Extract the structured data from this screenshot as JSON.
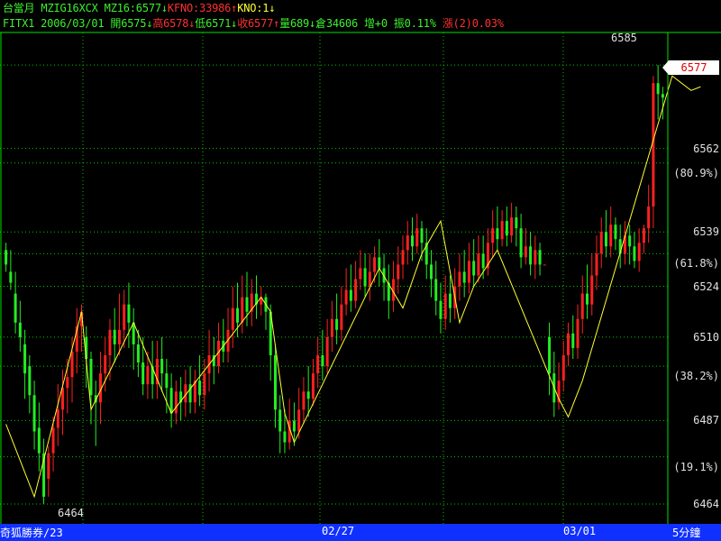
{
  "header": {
    "line1": [
      {
        "text": "台當月 MZIG16XCX MZ16:6577↓",
        "color": "grn"
      },
      {
        "text": "KFNO:33986↑",
        "color": "red"
      },
      {
        "text": "KNO:1↓",
        "color": "yel"
      }
    ],
    "line2": [
      {
        "text": "FITX1 2006/03/01 開6575↓",
        "color": "grn"
      },
      {
        "text": "高6578↓",
        "color": "red"
      },
      {
        "text": "低6571↓",
        "color": "grn"
      },
      {
        "text": "收6577↑",
        "color": "red"
      },
      {
        "text": "量689↓倉34606 增+0 振0.11% ",
        "color": "grn"
      },
      {
        "text": "漲(2)0.03%",
        "color": "red"
      }
    ]
  },
  "chart_data": {
    "type": "candlestick",
    "ylim": [
      6462,
      6590
    ],
    "y_ticks": [
      6585,
      6562,
      6539,
      6524,
      6510,
      6487,
      6464
    ],
    "fib_levels": [
      {
        "label": "(80.9%)",
        "value": 6558
      },
      {
        "label": "(61.8%)",
        "value": 6533
      },
      {
        "label": "(38.2%)",
        "value": 6502
      },
      {
        "label": "(19.1%)",
        "value": 6477
      }
    ],
    "x_labels": [
      {
        "text": "奇狐勝券/23",
        "slot": 0
      },
      {
        "text": "02/27",
        "slot": 1
      },
      {
        "text": "03/01",
        "slot": 2
      }
    ],
    "timeframe": "5分鐘",
    "last_price": "6577",
    "high_label": "6585",
    "low_label": "6464",
    "colors": {
      "up": "#ff2020",
      "down": "#22ee22",
      "zigzag": "#ffff30",
      "grid": "#00c800",
      "axis": "#00e000"
    },
    "zigzag": [
      [
        0,
        6486
      ],
      [
        6,
        6466
      ],
      [
        16,
        6517
      ],
      [
        18,
        6490
      ],
      [
        27,
        6514
      ],
      [
        35,
        6489
      ],
      [
        54,
        6521
      ],
      [
        56,
        6517
      ],
      [
        59,
        6489
      ],
      [
        61,
        6481
      ],
      [
        79,
        6529
      ],
      [
        84,
        6518
      ],
      [
        88,
        6533
      ],
      [
        92,
        6542
      ],
      [
        96,
        6514
      ],
      [
        99,
        6524
      ],
      [
        104,
        6534
      ],
      [
        117,
        6493
      ],
      [
        119,
        6488
      ],
      [
        122,
        6498
      ],
      [
        141,
        6582
      ],
      [
        145,
        6578
      ],
      [
        147,
        6579
      ]
    ],
    "candles": [
      [
        6534,
        6530,
        6536,
        6528
      ],
      [
        6528,
        6525,
        6534,
        6523
      ],
      [
        6522,
        6514,
        6528,
        6511
      ],
      [
        6514,
        6510,
        6520,
        6506
      ],
      [
        6508,
        6500,
        6512,
        6493
      ],
      [
        6502,
        6494,
        6505,
        6489
      ],
      [
        6494,
        6484,
        6498,
        6479
      ],
      [
        6485,
        6478,
        6492,
        6473
      ],
      [
        6478,
        6466,
        6482,
        6464
      ],
      [
        6471,
        6478,
        6480,
        6466
      ],
      [
        6478,
        6485,
        6488,
        6473
      ],
      [
        6485,
        6490,
        6497,
        6480
      ],
      [
        6490,
        6496,
        6501,
        6483
      ],
      [
        6496,
        6499,
        6504,
        6489
      ],
      [
        6499,
        6506,
        6510,
        6492
      ],
      [
        6506,
        6513,
        6518,
        6500
      ],
      [
        6513,
        6517,
        6519,
        6506
      ],
      [
        6510,
        6504,
        6513,
        6496
      ],
      [
        6504,
        6494,
        6506,
        6486
      ],
      [
        6494,
        6492,
        6498,
        6480
      ],
      [
        6492,
        6500,
        6506,
        6486
      ],
      [
        6500,
        6505,
        6510,
        6495
      ],
      [
        6505,
        6512,
        6515,
        6498
      ],
      [
        6512,
        6508,
        6518,
        6503
      ],
      [
        6508,
        6512,
        6522,
        6505
      ],
      [
        6512,
        6519,
        6523,
        6507
      ],
      [
        6519,
        6514,
        6525,
        6507
      ],
      [
        6514,
        6508,
        6518,
        6501
      ],
      [
        6508,
        6503,
        6512,
        6499
      ],
      [
        6503,
        6497,
        6510,
        6494
      ],
      [
        6497,
        6502,
        6506,
        6493
      ],
      [
        6502,
        6497,
        6509,
        6493
      ],
      [
        6497,
        6504,
        6509,
        6493
      ],
      [
        6504,
        6500,
        6510,
        6495
      ],
      [
        6500,
        6496,
        6504,
        6489
      ],
      [
        6496,
        6489,
        6500,
        6485
      ],
      [
        6489,
        6495,
        6498,
        6486
      ],
      [
        6495,
        6492,
        6499,
        6487
      ],
      [
        6492,
        6497,
        6501,
        6488
      ],
      [
        6497,
        6492,
        6502,
        6489
      ],
      [
        6492,
        6498,
        6501,
        6489
      ],
      [
        6498,
        6494,
        6505,
        6491
      ],
      [
        6494,
        6500,
        6504,
        6490
      ],
      [
        6500,
        6505,
        6512,
        6495
      ],
      [
        6505,
        6502,
        6510,
        6497
      ],
      [
        6502,
        6509,
        6514,
        6500
      ],
      [
        6509,
        6506,
        6515,
        6503
      ],
      [
        6506,
        6512,
        6518,
        6503
      ],
      [
        6512,
        6518,
        6524,
        6507
      ],
      [
        6518,
        6514,
        6525,
        6510
      ],
      [
        6514,
        6521,
        6527,
        6511
      ],
      [
        6521,
        6517,
        6528,
        6513
      ],
      [
        6517,
        6522,
        6526,
        6513
      ],
      [
        6522,
        6519,
        6527,
        6515
      ],
      [
        6519,
        6521,
        6524,
        6516
      ],
      [
        6521,
        6517,
        6522,
        6512
      ],
      [
        6517,
        6505,
        6519,
        6498
      ],
      [
        6505,
        6490,
        6508,
        6485
      ],
      [
        6490,
        6484,
        6494,
        6478
      ],
      [
        6484,
        6481,
        6490,
        6478
      ],
      [
        6481,
        6487,
        6493,
        6479
      ],
      [
        6487,
        6484,
        6492,
        6480
      ],
      [
        6484,
        6490,
        6496,
        6482
      ],
      [
        6490,
        6495,
        6499,
        6486
      ],
      [
        6495,
        6493,
        6502,
        6488
      ],
      [
        6493,
        6500,
        6504,
        6491
      ],
      [
        6500,
        6505,
        6510,
        6496
      ],
      [
        6505,
        6502,
        6512,
        6498
      ],
      [
        6502,
        6510,
        6515,
        6500
      ],
      [
        6510,
        6515,
        6520,
        6506
      ],
      [
        6515,
        6512,
        6522,
        6508
      ],
      [
        6512,
        6519,
        6524,
        6509
      ],
      [
        6519,
        6523,
        6529,
        6516
      ],
      [
        6523,
        6520,
        6530,
        6517
      ],
      [
        6520,
        6526,
        6531,
        6518
      ],
      [
        6526,
        6529,
        6534,
        6523
      ],
      [
        6529,
        6524,
        6533,
        6521
      ],
      [
        6524,
        6528,
        6533,
        6520
      ],
      [
        6528,
        6532,
        6535,
        6525
      ],
      [
        6532,
        6529,
        6537,
        6524
      ],
      [
        6529,
        6525,
        6533,
        6520
      ],
      [
        6525,
        6520,
        6530,
        6515
      ],
      [
        6520,
        6526,
        6531,
        6517
      ],
      [
        6526,
        6530,
        6535,
        6522
      ],
      [
        6530,
        6534,
        6538,
        6526
      ],
      [
        6534,
        6538,
        6542,
        6530
      ],
      [
        6538,
        6535,
        6543,
        6531
      ],
      [
        6535,
        6540,
        6544,
        6533
      ],
      [
        6540,
        6536,
        6542,
        6531
      ],
      [
        6536,
        6530,
        6540,
        6526
      ],
      [
        6530,
        6526,
        6534,
        6521
      ],
      [
        6526,
        6520,
        6531,
        6516
      ],
      [
        6520,
        6515,
        6525,
        6511
      ],
      [
        6515,
        6522,
        6527,
        6512
      ],
      [
        6522,
        6518,
        6527,
        6514
      ],
      [
        6518,
        6524,
        6529,
        6515
      ],
      [
        6524,
        6528,
        6533,
        6520
      ],
      [
        6528,
        6525,
        6534,
        6521
      ],
      [
        6525,
        6531,
        6536,
        6522
      ],
      [
        6531,
        6527,
        6537,
        6524
      ],
      [
        6527,
        6533,
        6538,
        6525
      ],
      [
        6533,
        6529,
        6538,
        6526
      ],
      [
        6529,
        6536,
        6540,
        6527
      ],
      [
        6536,
        6540,
        6545,
        6532
      ],
      [
        6540,
        6537,
        6546,
        6534
      ],
      [
        6537,
        6542,
        6545,
        6535
      ],
      [
        6542,
        6538,
        6546,
        6535
      ],
      [
        6538,
        6543,
        6547,
        6536
      ],
      [
        6543,
        6540,
        6546,
        6535
      ],
      [
        6540,
        6532,
        6544,
        6529
      ],
      [
        6532,
        6535,
        6540,
        6530
      ],
      [
        6535,
        6530,
        6539,
        6527
      ],
      [
        6530,
        6534,
        6538,
        6526
      ],
      [
        6534,
        6530,
        6536,
        6527
      ],
      [
        6530,
        6530,
        6530,
        6530
      ],
      [
        6510,
        6500,
        6514,
        6494
      ],
      [
        6500,
        6492,
        6506,
        6488
      ],
      [
        6492,
        6498,
        6503,
        6490
      ],
      [
        6498,
        6505,
        6509,
        6495
      ],
      [
        6505,
        6511,
        6514,
        6502
      ],
      [
        6511,
        6507,
        6516,
        6504
      ],
      [
        6507,
        6515,
        6519,
        6504
      ],
      [
        6515,
        6522,
        6527,
        6511
      ],
      [
        6522,
        6519,
        6530,
        6515
      ],
      [
        6519,
        6527,
        6533,
        6516
      ],
      [
        6527,
        6533,
        6538,
        6523
      ],
      [
        6533,
        6539,
        6543,
        6529
      ],
      [
        6539,
        6535,
        6545,
        6532
      ],
      [
        6535,
        6541,
        6546,
        6532
      ],
      [
        6541,
        6537,
        6543,
        6534
      ],
      [
        6537,
        6533,
        6541,
        6529
      ],
      [
        6533,
        6538,
        6542,
        6530
      ],
      [
        6538,
        6535,
        6541,
        6530
      ],
      [
        6535,
        6531,
        6539,
        6529
      ],
      [
        6531,
        6536,
        6540,
        6528
      ],
      [
        6536,
        6540,
        6541,
        6533
      ],
      [
        6540,
        6546,
        6552,
        6536
      ],
      [
        6546,
        6580,
        6582,
        6540
      ],
      [
        6580,
        6577,
        6585,
        6570
      ],
      [
        6577,
        6576,
        6579,
        6570
      ]
    ]
  }
}
